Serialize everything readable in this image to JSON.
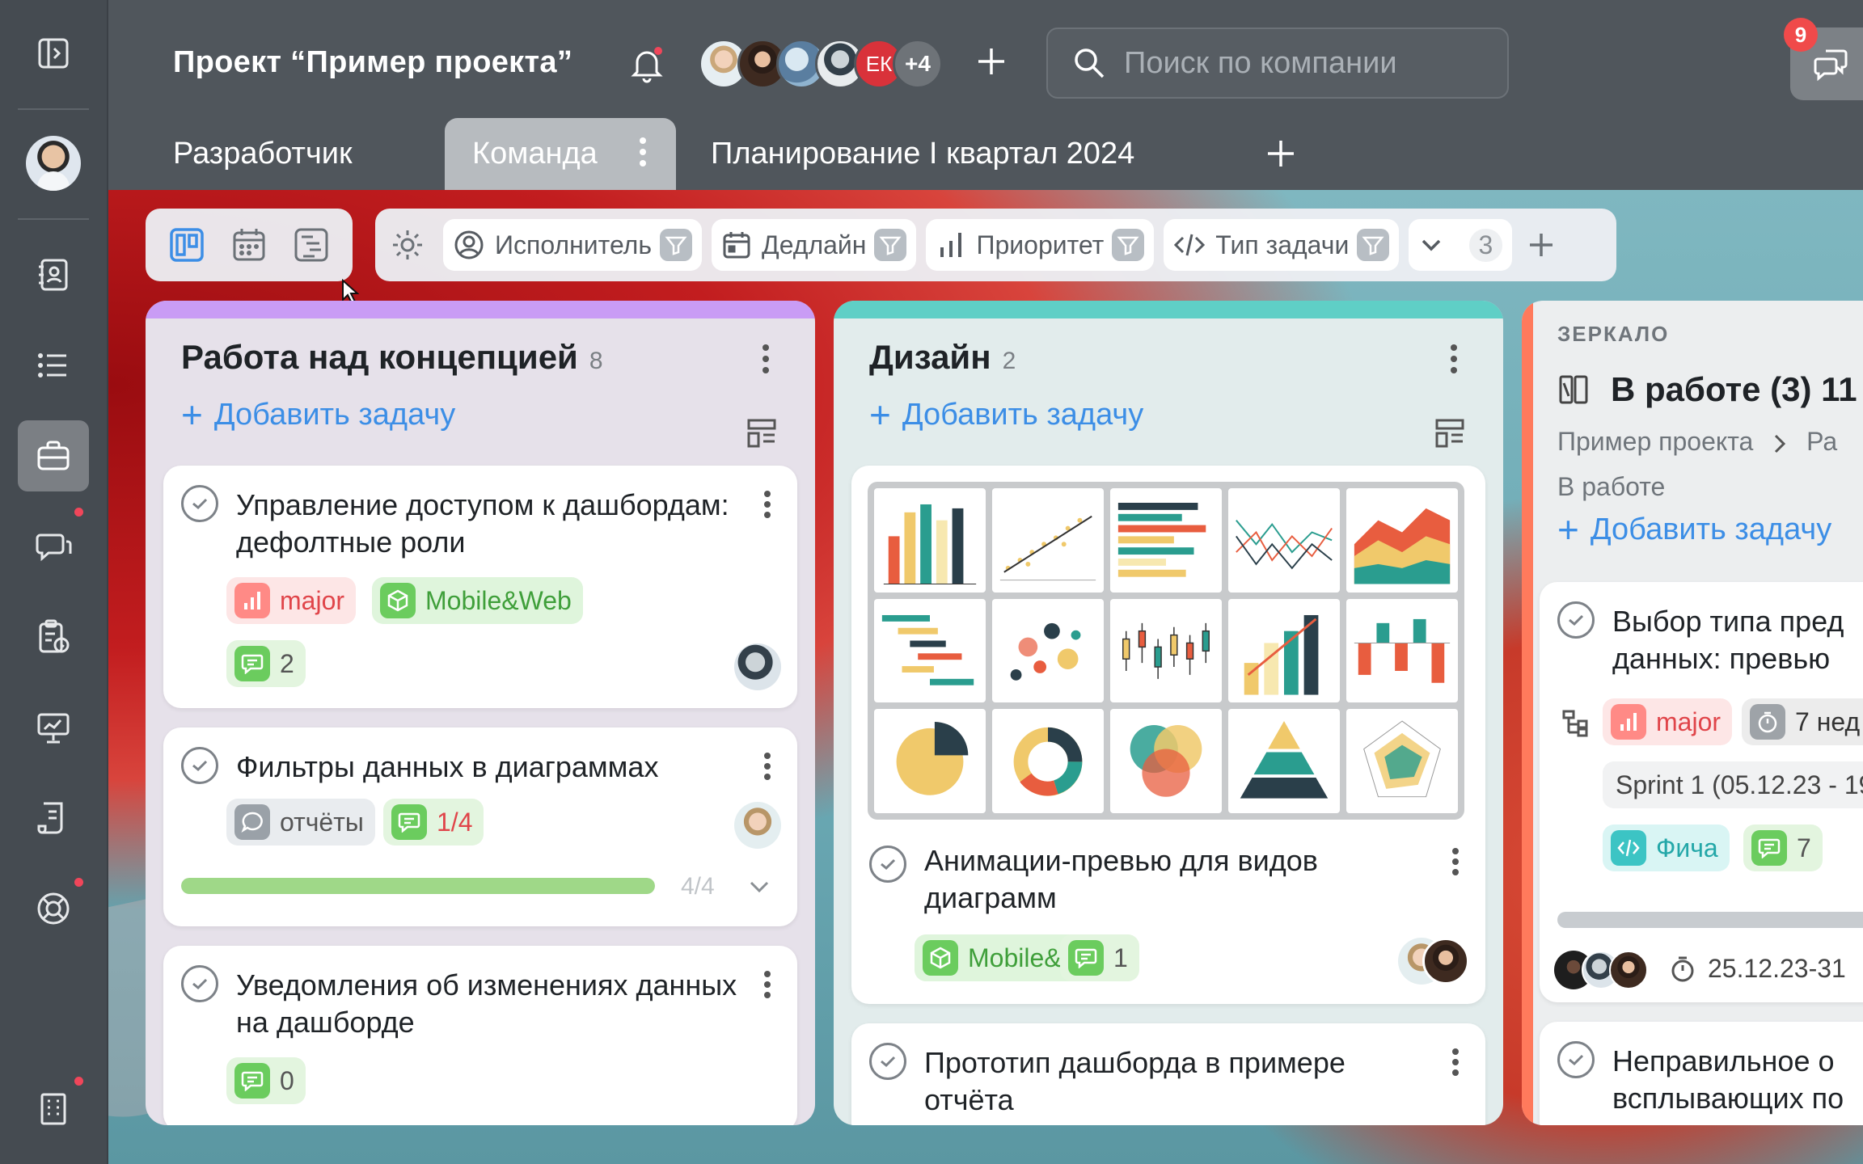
{
  "topbar": {
    "project_title": "Проект “Пример проекта”",
    "avatar_ek": "ЕК",
    "avatar_more": "+4",
    "search_placeholder": "Поиск по компании",
    "notifications_count": "9"
  },
  "tabs": [
    {
      "label": "Разработчик"
    },
    {
      "label": "Команда"
    },
    {
      "label": "Планирование I квартал 2024"
    }
  ],
  "filters": {
    "assignee": "Исполнитель",
    "deadline": "Дедлайн",
    "priority": "Приоритет",
    "task_type": "Тип задачи",
    "more_count": "3"
  },
  "columns": [
    {
      "title": "Работа над концепцией",
      "count": "8",
      "add_task": "Добавить задачу",
      "accent": "#c99cf5",
      "cards": [
        {
          "title": "Управление доступом к дашбордам: дефолтные роли",
          "tag_priority": "major",
          "tag_platform": "Mobile&Web",
          "comments": "2"
        },
        {
          "title": "Фильтры данных в диаграммах",
          "tag_type": "отчёты",
          "checklist": "1/4",
          "progress_label": "4/4",
          "progress": 1.0
        },
        {
          "title": "Уведомления об изменениях данных на дашборде",
          "comments": "0"
        }
      ]
    },
    {
      "title": "Дизайн",
      "count": "2",
      "add_task": "Добавить задачу",
      "accent": "#5fcfc6",
      "cards": [
        {
          "title": "Анимации-превью для видов диаграмм",
          "tag_platform": "Mobile&Web",
          "comments": "1"
        },
        {
          "title": "Прототип дашборда в примере отчёта"
        }
      ]
    },
    {
      "mirror_label": "ЗЕРКАЛО",
      "title": "В работе (3) 11",
      "path_project": "Пример проекта",
      "path_next": "Ра",
      "path_stage": "В работе",
      "add_task": "Добавить задачу",
      "accent": "#ff7a5c",
      "cards": [
        {
          "title": "Выбор типа пред данных: превью",
          "tag_priority": "major",
          "tag_time": "7 нед",
          "sprint": "Sprint 1 (05.12.23 - 19",
          "tag_type": "Фича",
          "comments": "7",
          "dates": "25.12.23-31"
        },
        {
          "title": "Неправильное о всплывающих по"
        }
      ]
    }
  ]
}
